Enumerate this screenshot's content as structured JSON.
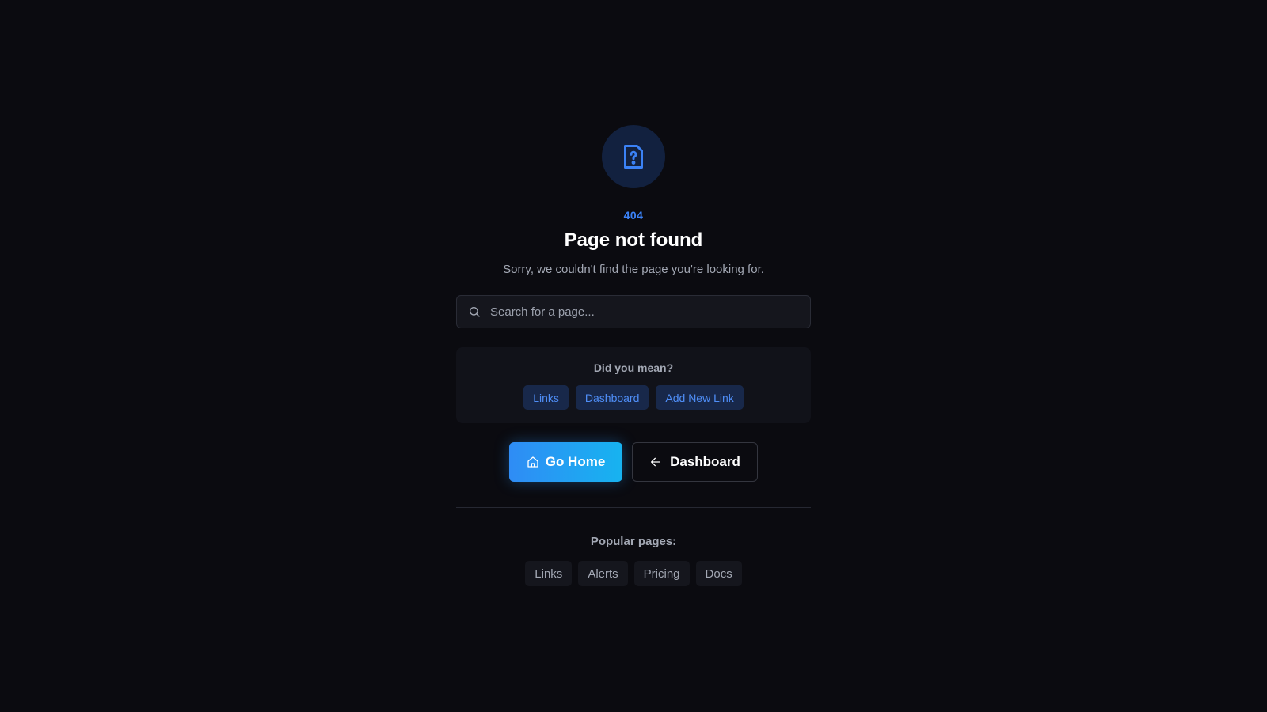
{
  "error": {
    "icon": "file-question-icon",
    "code": "404",
    "title": "Page not found",
    "message": "Sorry, we couldn't find the page you're looking for."
  },
  "search": {
    "icon": "search-icon",
    "placeholder": "Search for a page...",
    "value": ""
  },
  "suggestions": {
    "label": "Did you mean?",
    "items": [
      "Links",
      "Dashboard",
      "Add New Link"
    ]
  },
  "actions": {
    "primary": {
      "label": "Go Home",
      "icon": "home-icon"
    },
    "secondary": {
      "label": "Dashboard",
      "icon": "arrow-left-icon"
    }
  },
  "popular": {
    "label": "Popular pages:",
    "items": [
      "Links",
      "Alerts",
      "Pricing",
      "Docs"
    ]
  },
  "colors": {
    "background": "#0b0b10",
    "accent": "#3b82f6",
    "primary_gradient_start": "#2f8cf5",
    "primary_gradient_end": "#17b3f0"
  }
}
